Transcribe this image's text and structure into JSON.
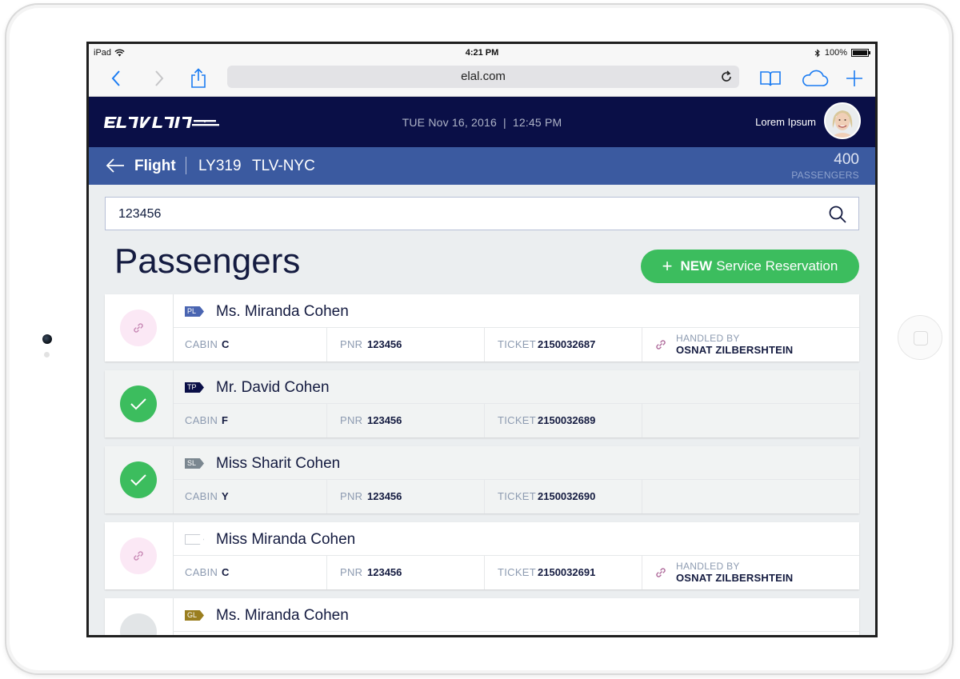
{
  "status_bar": {
    "device": "iPad",
    "time": "4:21 PM",
    "battery": "100%"
  },
  "browser": {
    "url": "elal.com"
  },
  "header": {
    "logo_text": "EL AL",
    "date": "TUE Nov 16, 2016",
    "separator": "|",
    "time": "12:45 PM",
    "user_name": "Lorem Ipsum"
  },
  "flight_bar": {
    "title": "Flight",
    "flight_number": "LY319",
    "route": "TLV-NYC",
    "passenger_count": "400",
    "passenger_label": "PASSENGERS"
  },
  "search": {
    "value": "123456",
    "placeholder": ""
  },
  "main": {
    "title": "Passengers",
    "new_button": {
      "plus": "+",
      "bold": "NEW",
      "rest": "Service Reservation"
    }
  },
  "labels": {
    "cabin": "CABIN",
    "pnr": "PNR",
    "ticket": "TICKET",
    "handled_by": "HANDLED BY"
  },
  "colors": {
    "navy": "#0a0f47",
    "blue": "#3b5aa0",
    "green": "#3cbd5e",
    "pink": "#fbe8f5"
  },
  "passengers": [
    {
      "status": "link",
      "tier": "PL",
      "tier_color": "#4a65b1",
      "name": "Ms. Miranda Cohen",
      "cabin": "C",
      "pnr": "123456",
      "ticket": "2150032687",
      "handled_by": "OSNAT ZILBERSHTEIN"
    },
    {
      "status": "check",
      "tier": "TP",
      "tier_color": "#0a0f47",
      "name": "Mr. David Cohen",
      "cabin": "F",
      "pnr": "123456",
      "ticket": "2150032689",
      "handled_by": ""
    },
    {
      "status": "check",
      "tier": "SL",
      "tier_color": "#7b8790",
      "name": "Miss Sharit Cohen",
      "cabin": "Y",
      "pnr": "123456",
      "ticket": "2150032690",
      "handled_by": ""
    },
    {
      "status": "link",
      "tier": "",
      "tier_color": "#ffffff",
      "name": "Miss Miranda Cohen",
      "cabin": "C",
      "pnr": "123456",
      "ticket": "2150032691",
      "handled_by": "OSNAT ZILBERSHTEIN"
    },
    {
      "status": "empty",
      "tier": "GL",
      "tier_color": "#9a7e1f",
      "name": "Ms. Miranda Cohen",
      "cabin": "",
      "pnr": "",
      "ticket": "",
      "handled_by": ""
    }
  ]
}
